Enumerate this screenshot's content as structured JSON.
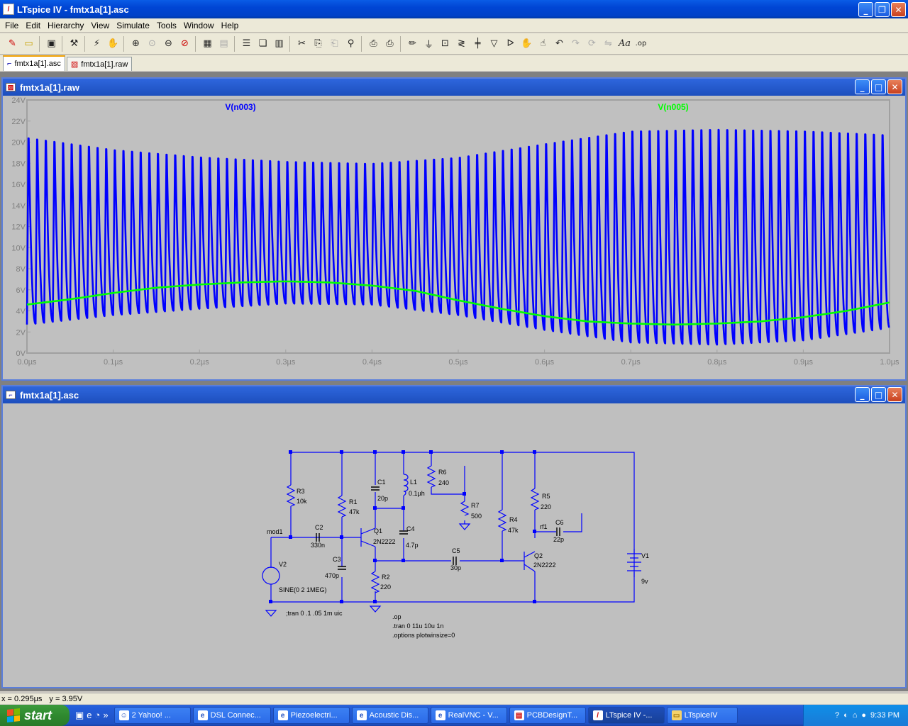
{
  "window": {
    "title": "LTspice IV - fmtx1a[1].asc"
  },
  "menu": [
    {
      "label": "File",
      "mnemonic": "F"
    },
    {
      "label": "Edit",
      "mnemonic": "E"
    },
    {
      "label": "Hierarchy",
      "mnemonic": "H"
    },
    {
      "label": "View",
      "mnemonic": "V"
    },
    {
      "label": "Simulate",
      "mnemonic": "S"
    },
    {
      "label": "Tools",
      "mnemonic": "T"
    },
    {
      "label": "Window",
      "mnemonic": "W"
    },
    {
      "label": "Help",
      "mnemonic": "H"
    }
  ],
  "toolbar_icons": [
    "new-schematic-icon",
    "open-icon",
    "save-icon",
    "control-panel-icon",
    "run-icon",
    "halt-icon",
    "zoom-in-icon",
    "zoom-fit-icon",
    "zoom-out-icon",
    "zoom-cancel-icon",
    "autorange-icon",
    "grid-icon",
    "tile-horizontal-icon",
    "cascade-icon",
    "tile-vertical-icon",
    "cut-icon",
    "copy-icon",
    "paste-icon",
    "find-icon",
    "print-preview-icon",
    "print-icon",
    "wire-icon",
    "ground-icon",
    "label-icon",
    "resistor-icon",
    "capacitor-icon",
    "diode-icon",
    "component-icon",
    "move-icon",
    "drag-icon",
    "undo-icon",
    "redo-icon",
    "rotate-icon",
    "mirror-icon",
    "text-icon",
    "spice-directive-icon"
  ],
  "tabs": [
    {
      "label": "fmtx1a[1].asc",
      "active": true
    },
    {
      "label": "fmtx1a[1].raw",
      "active": false
    }
  ],
  "wave_window": {
    "title": "fmtx1a[1].raw"
  },
  "schem_window": {
    "title": "fmtx1a[1].asc"
  },
  "chart_data": {
    "type": "line",
    "traces": [
      {
        "name": "V(n003)",
        "color": "#0000ff"
      },
      {
        "name": "V(n005)",
        "color": "#00ff00"
      }
    ],
    "x_ticks": [
      "0.0µs",
      "0.1µs",
      "0.2µs",
      "0.3µs",
      "0.4µs",
      "0.5µs",
      "0.6µs",
      "0.7µs",
      "0.8µs",
      "0.9µs",
      "1.0µs"
    ],
    "y_ticks": [
      "0V",
      "2V",
      "4V",
      "6V",
      "8V",
      "10V",
      "12V",
      "14V",
      "16V",
      "18V",
      "20V",
      "22V",
      "24V"
    ],
    "xlim": [
      0,
      1.0
    ],
    "ylim": [
      0,
      24
    ],
    "x_unit": "µs",
    "y_unit": "V",
    "grid": false,
    "v_n003": {
      "cycles": 100,
      "peak_envelope": [
        [
          0.0,
          21.8
        ],
        [
          0.1,
          20.5
        ],
        [
          0.2,
          19.7
        ],
        [
          0.3,
          19.2
        ],
        [
          0.4,
          19.0
        ],
        [
          0.5,
          19.7
        ],
        [
          0.6,
          21.2
        ],
        [
          0.7,
          22.6
        ],
        [
          0.8,
          22.8
        ],
        [
          0.9,
          22.6
        ],
        [
          1.0,
          22.1
        ]
      ],
      "trough_envelope": [
        [
          0.0,
          2.7
        ],
        [
          0.1,
          3.6
        ],
        [
          0.2,
          4.2
        ],
        [
          0.3,
          4.7
        ],
        [
          0.4,
          4.6
        ],
        [
          0.5,
          3.6
        ],
        [
          0.6,
          2.2
        ],
        [
          0.7,
          1.0
        ],
        [
          0.8,
          0.8
        ],
        [
          0.9,
          1.2
        ],
        [
          1.0,
          2.4
        ]
      ]
    },
    "v_n005": [
      [
        0.0,
        4.6
      ],
      [
        0.05,
        5.1
      ],
      [
        0.1,
        5.7
      ],
      [
        0.15,
        6.2
      ],
      [
        0.2,
        6.5
      ],
      [
        0.25,
        6.7
      ],
      [
        0.3,
        6.8
      ],
      [
        0.35,
        6.7
      ],
      [
        0.4,
        6.4
      ],
      [
        0.45,
        5.9
      ],
      [
        0.5,
        5.0
      ],
      [
        0.55,
        4.2
      ],
      [
        0.6,
        3.5
      ],
      [
        0.65,
        3.0
      ],
      [
        0.7,
        2.8
      ],
      [
        0.75,
        2.7
      ],
      [
        0.8,
        2.8
      ],
      [
        0.85,
        3.0
      ],
      [
        0.9,
        3.4
      ],
      [
        0.95,
        4.0
      ],
      [
        1.0,
        4.8
      ]
    ]
  },
  "schematic": {
    "labels": {
      "r3": "R3",
      "r3v": "10k",
      "r1": "R1",
      "r1v": "47k",
      "c1": "C1",
      "c1v": "20p",
      "l1": "L1",
      "l1v": "0.1µh",
      "r6": "R6",
      "r6v": "240",
      "r7": "R7",
      "r7v": "500",
      "r5": "R5",
      "r5v": "220",
      "r4": "R4",
      "r4v": "47k",
      "c6": "C6",
      "c6v": "22p",
      "rf1": "rf1",
      "mod1": "mod1",
      "c2": "C2",
      "c2v": "330n",
      "q1": "Q1",
      "q1v": "2N2222",
      "c4": "C4",
      "c4v": "4.7p",
      "c3": "C3",
      "c3v": "470p",
      "c5": "C5",
      "c5v": "30p",
      "q2": "Q2",
      "q2v": "2N2222",
      "v1": "V1",
      "v1v": "9v",
      "v2": "V2",
      "v2v": "SINE(0 2 1MEG)",
      "r2": "R2",
      "r2v": "220",
      "tran_comment": ";tran 0 .1 .05 1m uic",
      "op": ".op",
      "tran": ".tran 0 11u 10u 1n",
      "options": ".options plotwinsize=0"
    }
  },
  "status": {
    "x": "x = 0.295µs",
    "y": "y = 3.95V"
  },
  "taskbar": {
    "start": "start",
    "tasks": [
      {
        "label": "2 Yahoo! ...",
        "active": false
      },
      {
        "label": "DSL Connec...",
        "active": false
      },
      {
        "label": "Piezoelectri...",
        "active": false
      },
      {
        "label": "Acoustic Dis...",
        "active": false
      },
      {
        "label": "RealVNC - V...",
        "active": false
      },
      {
        "label": "PCBDesignT...",
        "active": false
      },
      {
        "label": "LTspice IV -...",
        "active": true
      },
      {
        "label": "LTspiceIV",
        "active": false
      }
    ],
    "clock": "9:33 PM"
  }
}
